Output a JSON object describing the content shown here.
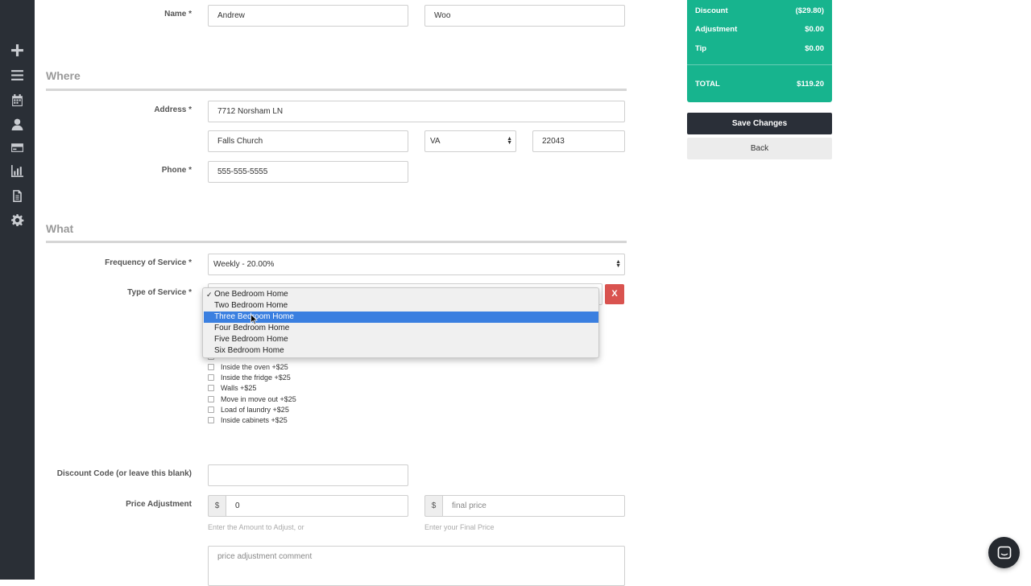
{
  "sidebar": {
    "icons": [
      "plus-icon",
      "menu-icon",
      "calendar-icon",
      "user-icon",
      "credit-card-icon",
      "bar-chart-icon",
      "document-icon",
      "gear-icon"
    ]
  },
  "who": {
    "name_label": "Name *",
    "first_name": "Andrew",
    "last_name": "Woo"
  },
  "where": {
    "title": "Where",
    "address_label": "Address *",
    "address": "7712 Norsham LN",
    "city": "Falls Church",
    "state": "VA",
    "zip": "22043",
    "phone_label": "Phone *",
    "phone": "555-555-5555"
  },
  "what": {
    "title": "What",
    "frequency_label": "Frequency of Service *",
    "frequency_value": "Weekly - 20.00%",
    "type_label": "Type of Service *",
    "remove_label": "X",
    "type_options": [
      {
        "label": "One Bedroom Home",
        "checked": "✓"
      },
      {
        "label": "Two Bedroom Home"
      },
      {
        "label": "Three Bedroom Home"
      },
      {
        "label": "Four Bedroom Home"
      },
      {
        "label": "Five Bedroom Home"
      },
      {
        "label": "Six Bedroom Home"
      }
    ],
    "extras": [
      "Inside the oven +$25",
      "Inside the fridge +$25",
      "Walls +$25",
      "Move in move out +$25",
      "Load of laundry +$25",
      "Inside cabinets +$25"
    ]
  },
  "discount": {
    "label": "Discount Code (or leave this blank)",
    "value": ""
  },
  "price_adjustment": {
    "label": "Price Adjustment",
    "currency": "$",
    "amount_value": "0",
    "amount_help": "Enter the Amount to Adjust, or",
    "final_placeholder": "final price",
    "final_help": "Enter your Final Price",
    "comment_placeholder": "price adjustment comment"
  },
  "summary": {
    "rows": [
      {
        "label": "Discount",
        "value": "($29.80)"
      },
      {
        "label": "Adjustment",
        "value": "$0.00"
      },
      {
        "label": "Tip",
        "value": "$0.00"
      }
    ],
    "total_label": "TOTAL",
    "total_value": "$119.20",
    "accent_color": "#17b48e"
  },
  "actions": {
    "save_label": "Save Changes",
    "back_label": "Back"
  }
}
